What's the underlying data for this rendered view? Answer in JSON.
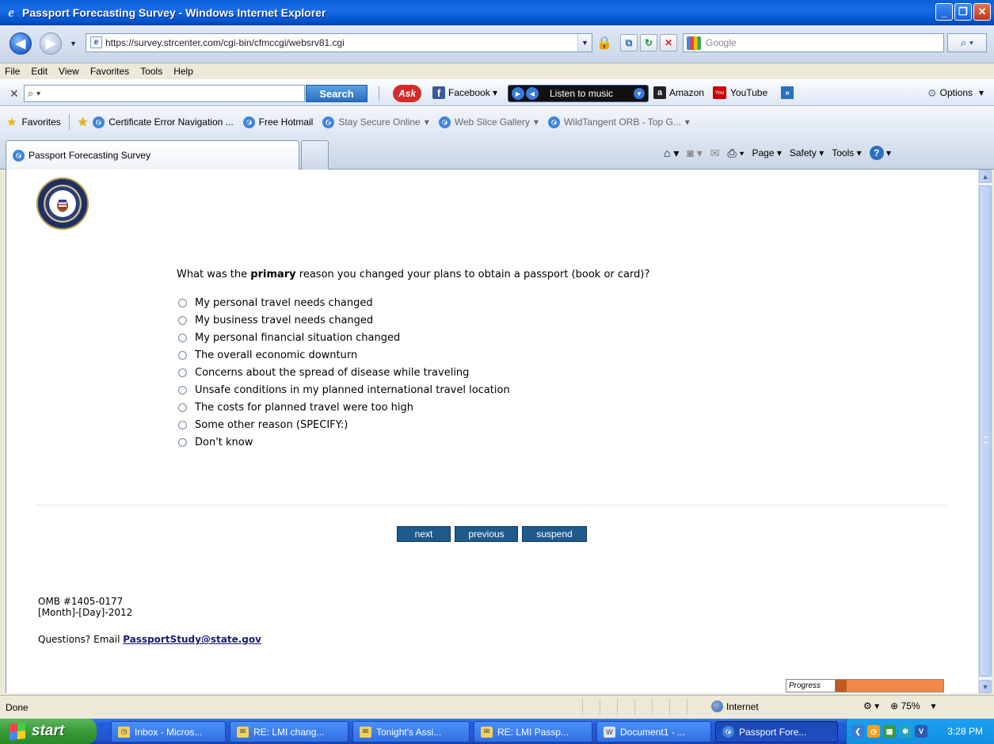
{
  "window": {
    "title": "Passport Forecasting Survey - Windows Internet Explorer"
  },
  "address": {
    "url": "https://survey.strcenter.com/cgi-bin/cfmccgi/websrv81.cgi",
    "search_placeholder": "Google"
  },
  "menu": [
    "File",
    "Edit",
    "View",
    "Favorites",
    "Tools",
    "Help"
  ],
  "ask_toolbar": {
    "search_label": "Search",
    "facebook": "Facebook",
    "music": "Listen to music",
    "amazon": "Amazon",
    "youtube": "YouTube",
    "options": "Options"
  },
  "favorites": {
    "label": "Favorites",
    "items": [
      "Certificate Error Navigation ...",
      "Free Hotmail",
      "Stay Secure Online",
      "Web Slice Gallery",
      "WildTangent ORB - Top G..."
    ]
  },
  "tab": {
    "title": "Passport Forecasting Survey"
  },
  "commandbar": {
    "page": "Page",
    "safety": "Safety",
    "tools": "Tools"
  },
  "survey": {
    "question_pre": "What was the ",
    "question_bold": "primary",
    "question_post": " reason you changed your plans to obtain a passport (book or card)?",
    "options": [
      "My personal travel needs changed",
      "My business travel needs changed",
      "My personal financial situation changed",
      "The overall economic downturn",
      "Concerns about the spread of disease while traveling",
      "Unsafe conditions in my planned international travel location",
      "The costs for planned travel were too high",
      "Some other reason (SPECIFY:)",
      "Don't know"
    ],
    "buttons": {
      "next": "next",
      "previous": "previous",
      "suspend": "suspend"
    },
    "omb": "OMB #1405-0177",
    "date": "[Month]-[Day]-2012",
    "questions_prefix": "Questions? Email ",
    "email": "PassportStudy@state.gov",
    "progress_label": "Progress",
    "progress_fraction": 0.1
  },
  "status": {
    "text": "Done",
    "zone": "Internet",
    "zoom": "75%"
  },
  "taskbar": {
    "start": "start",
    "tasks": [
      "Inbox - Micros...",
      "RE: LMI chang...",
      "Tonight's Assi...",
      "RE: LMI Passp...",
      "Document1 - ...",
      "Passport Fore..."
    ],
    "clock": "3:28 PM"
  },
  "colors": {
    "button_bg": "#1e5a8c",
    "progress_bar": "#f08848",
    "titlebar": "#0a5fd8"
  }
}
